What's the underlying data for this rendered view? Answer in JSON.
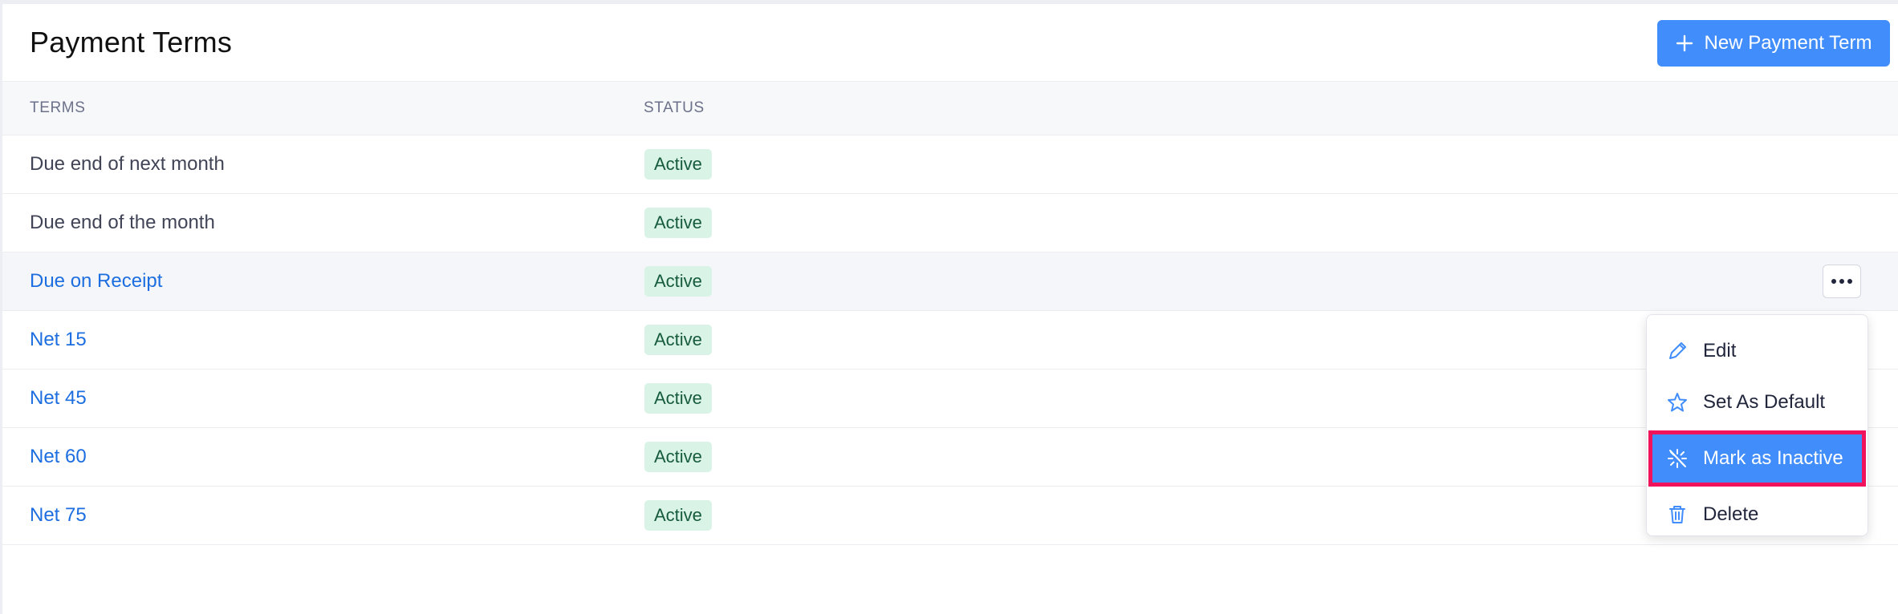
{
  "header": {
    "title": "Payment Terms",
    "new_button_label": "New Payment Term"
  },
  "table": {
    "columns": [
      "TERMS",
      "STATUS"
    ],
    "rows": [
      {
        "term": "Due end of next month",
        "status": "Active"
      },
      {
        "term": "Due end of the month",
        "status": "Active"
      },
      {
        "term": "Due on Receipt",
        "status": "Active"
      },
      {
        "term": "Net 15",
        "status": "Active"
      },
      {
        "term": "Net 45",
        "status": "Active"
      },
      {
        "term": "Net 60",
        "status": "Active"
      },
      {
        "term": "Net 75",
        "status": "Active"
      }
    ]
  },
  "row_menu": {
    "items": [
      {
        "label": "Edit",
        "icon": "pencil-icon"
      },
      {
        "label": "Set As Default",
        "icon": "star-icon"
      },
      {
        "label": "Mark as Inactive",
        "icon": "inactive-icon",
        "highlighted": true
      },
      {
        "label": "Delete",
        "icon": "trash-icon"
      }
    ]
  },
  "colors": {
    "accent": "#408dfb",
    "link": "#1d6ee0",
    "badge_bg": "#d9f3e6",
    "badge_text": "#165b3c",
    "highlight_outline": "#f0135b"
  }
}
